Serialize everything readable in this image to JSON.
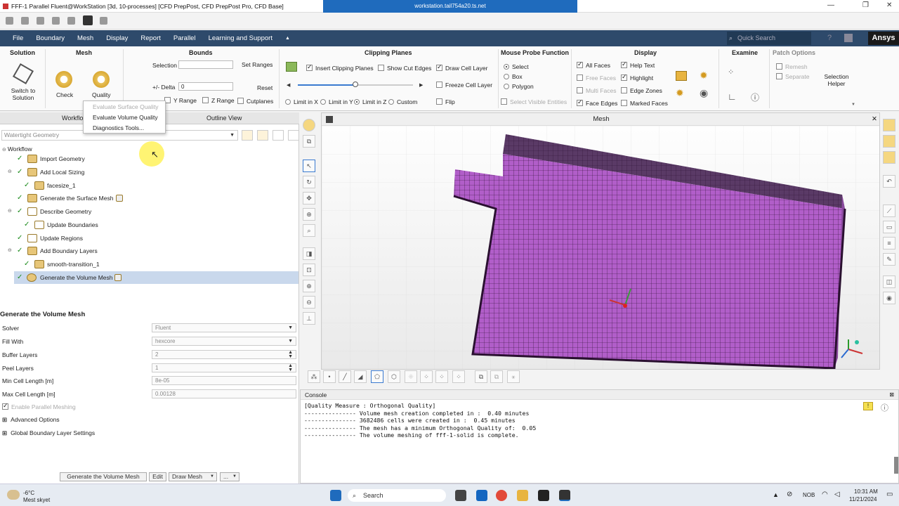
{
  "window": {
    "title": "FFF-1 Parallel Fluent@WorkStation  [3d, 10-processes] [CFD PrepPost, CFD PrepPost Pro, CFD Base]",
    "remote_session": "workstation.tail754a20.ts.net"
  },
  "menu": [
    "File",
    "Boundary",
    "Mesh",
    "Display",
    "Report",
    "Parallel",
    "Learning and Support"
  ],
  "search_placeholder": "Quick Search",
  "brand": "Ansys",
  "ribbon": {
    "solution": {
      "title": "Solution",
      "switch_label": "Switch to Solution"
    },
    "mesh": {
      "title": "Mesh",
      "check": "Check",
      "quality": "Quality"
    },
    "bounds": {
      "title": "Bounds",
      "selection": "Selection",
      "set_ranges": "Set Ranges",
      "delta": "+/- Delta",
      "delta_value": "0",
      "reset": "Reset",
      "y_range": "Y Range",
      "z_range": "Z Range",
      "cutplanes": "Cutplanes"
    },
    "clipping": {
      "title": "Clipping Planes",
      "insert": "Insert Clipping Planes",
      "show_cut_edges": "Show Cut Edges",
      "draw_cell_layer": "Draw Cell Layer",
      "freeze": "Freeze Cell Layer",
      "flip": "Flip",
      "limits": [
        "Limit in X",
        "Limit in Y",
        "Limit in Z",
        "Custom"
      ]
    },
    "probe": {
      "title": "Mouse Probe Function",
      "options": [
        "Select",
        "Box",
        "Polygon"
      ],
      "select_visible": "Select Visible Entities"
    },
    "display": {
      "title": "Display",
      "all_faces": "All Faces",
      "free_faces": "Free Faces",
      "multi_faces": "Multi Faces",
      "face_edges": "Face Edges",
      "help_text": "Help Text",
      "highlight": "Highlight",
      "edge_zones": "Edge Zones",
      "marked_faces": "Marked Faces"
    },
    "examine": {
      "title": "Examine"
    },
    "patch": {
      "title": "Patch Options",
      "remesh": "Remesh",
      "separate": "Separate"
    },
    "selection_helper": "Selection Helper"
  },
  "quality_menu": [
    "Evaluate Surface Quality",
    "Evaluate Volume Quality",
    "Diagnostics Tools..."
  ],
  "left": {
    "tabs": [
      "Workflow",
      "Outline View"
    ],
    "workflow_type": "Watertight Geometry",
    "tree_root": "Workflow",
    "tree": [
      "Import Geometry",
      "Add Local Sizing",
      "facesize_1",
      "Generate the Surface Mesh",
      "Describe Geometry",
      "Update Boundaries",
      "Update Regions",
      "Add Boundary Layers",
      "smooth-transition_1",
      "Generate the Volume Mesh"
    ]
  },
  "task": {
    "title": "Generate the Volume Mesh",
    "fields": [
      {
        "label": "Solver",
        "value": "Fluent"
      },
      {
        "label": "Fill With",
        "value": "hexcore"
      },
      {
        "label": "Buffer Layers",
        "value": "2"
      },
      {
        "label": "Peel Layers",
        "value": "1"
      },
      {
        "label": "Min Cell Length [m]",
        "value": "8e-05"
      },
      {
        "label": "Max Cell Length [m]",
        "value": "0.00128"
      }
    ],
    "parallel": "Enable Parallel Meshing",
    "advanced": "Advanced Options",
    "global_bl": "Global Boundary Layer Settings",
    "buttons": [
      "Generate the Volume Mesh",
      "Edit",
      "Draw Mesh",
      "..."
    ]
  },
  "viewport": {
    "title": "Mesh"
  },
  "console": {
    "title": "Console",
    "lines": [
      "[Quality Measure : Orthogonal Quality]",
      "",
      "--------------- Volume mesh creation completed in :  0.40 minutes",
      "",
      "--------------- 3682486 cells were created in :  0.45 minutes",
      "",
      "--------------- The mesh has a minimum Orthogonal Quality of:  0.05",
      "",
      "--------------- The volume meshing of fff-1-solid is complete."
    ]
  },
  "taskbar": {
    "weather_temp": "-6°C",
    "weather_text": "Mest skyet",
    "search": "Search",
    "lang": "NOB",
    "time": "10:31 AM",
    "date": "11/21/2024"
  },
  "colors": {
    "menubar": "#2e4a6b",
    "mesh": "#b15ec9",
    "accent": "#1f6bbd"
  }
}
